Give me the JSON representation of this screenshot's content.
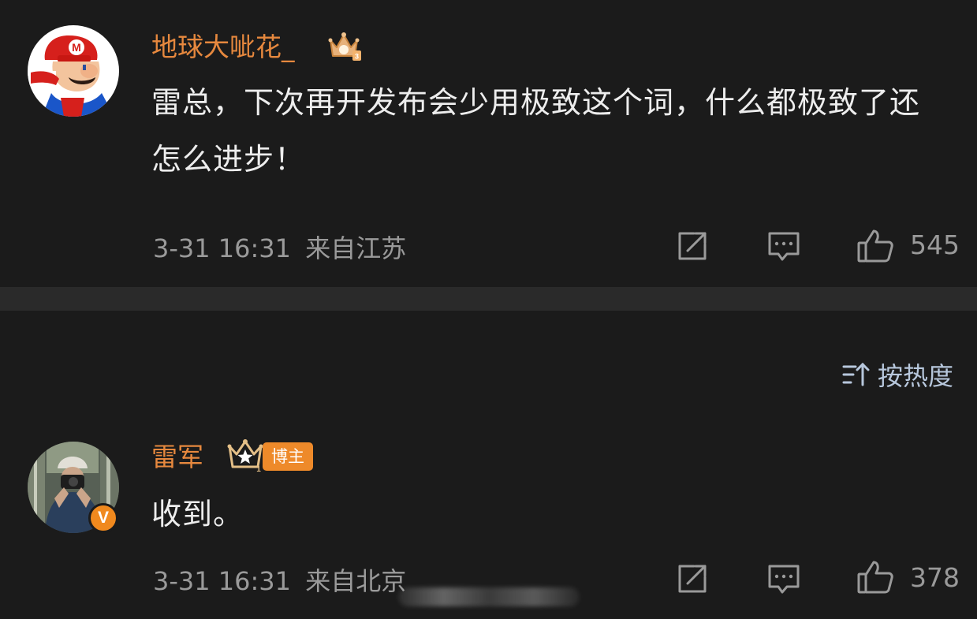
{
  "comments": [
    {
      "username": "地球大呲花_",
      "badge_icon": "crown-icon",
      "text": "雷总，下次再开发布会少用极致这个词，什么都极致了还怎么进步！",
      "date": "3-31 16:31",
      "location": "来自江苏",
      "likes": "545"
    },
    {
      "username": "雷军",
      "badge_icon": "crown-level-icon",
      "tag": "博主",
      "text": "收到。",
      "date": "3-31 16:31",
      "location": "来自北京",
      "likes": "378",
      "verified_icon": "verified-v-icon"
    }
  ],
  "sort": {
    "label": "按热度",
    "icon": "sort-icon"
  },
  "colors": {
    "background": "#1b1b1b",
    "username": "#e6883e",
    "meta": "#9a9a9a",
    "sort": "#b7c7dc"
  }
}
